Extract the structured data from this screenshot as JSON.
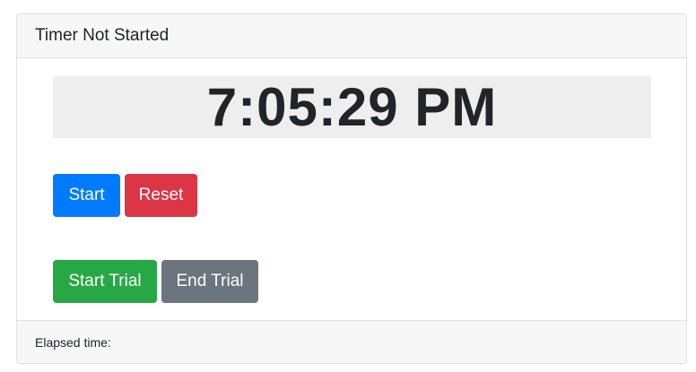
{
  "header": {
    "title": "Timer Not Started"
  },
  "clock": {
    "time": "7:05:29 PM"
  },
  "controls": {
    "start_label": "Start",
    "reset_label": "Reset",
    "start_trial_label": "Start Trial",
    "end_trial_label": "End Trial"
  },
  "footer": {
    "elapsed_label": "Elapsed time:"
  },
  "colors": {
    "start": "#007bff",
    "reset": "#dc3545",
    "start_trial": "#28a745",
    "end_trial": "#6c757d",
    "clock_background": "#eeeeee"
  }
}
